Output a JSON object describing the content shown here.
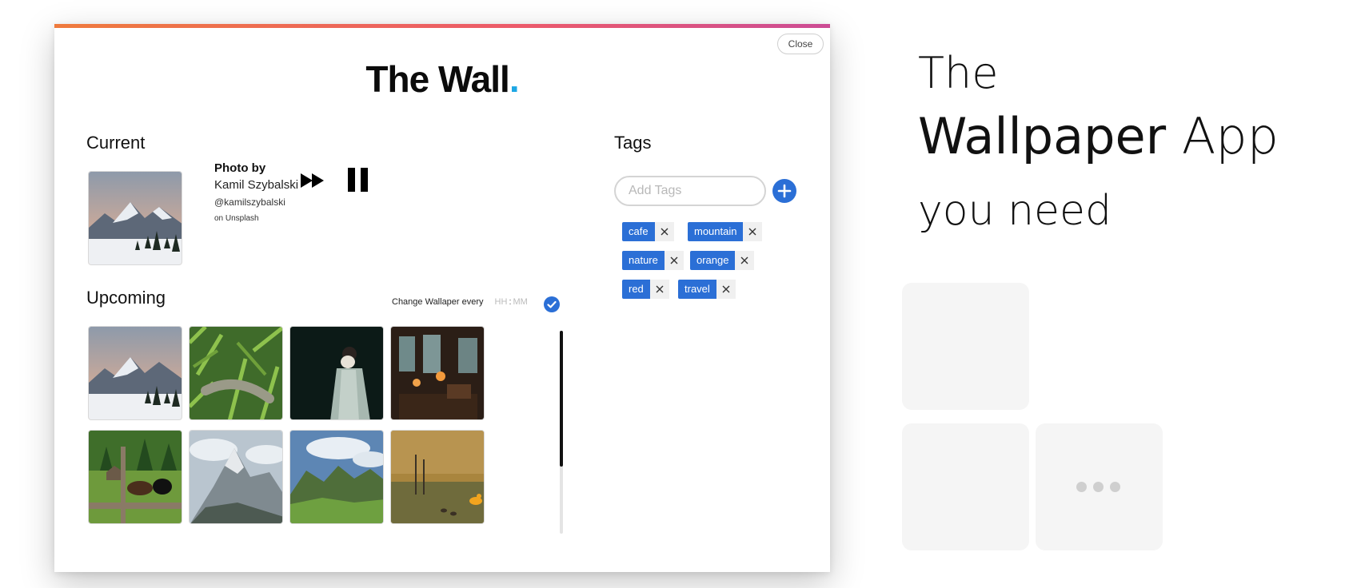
{
  "window": {
    "close_label": "Close",
    "title_main": "The Wall",
    "title_dot": "."
  },
  "current": {
    "heading": "Current",
    "credit_by": "Photo by",
    "credit_name": "Kamil Szybalski",
    "credit_handle": "@kamilszybalski",
    "credit_source": "on Unsplash"
  },
  "upcoming": {
    "heading": "Upcoming",
    "interval_label": "Change Wallaper every",
    "hh_placeholder": "HH",
    "separator": ":",
    "mm_placeholder": "MM",
    "photos": [
      "mountain-snow",
      "lizard-grass",
      "woman-fan",
      "cafe-interior",
      "cows-forest",
      "rocky-peak",
      "green-valley",
      "ducks-pond"
    ]
  },
  "tags": {
    "heading": "Tags",
    "input_placeholder": "Add Tags",
    "items": [
      {
        "label": "cafe"
      },
      {
        "label": "mountain"
      },
      {
        "label": "nature"
      },
      {
        "label": "orange"
      },
      {
        "label": "red"
      },
      {
        "label": "travel"
      }
    ]
  },
  "promo": {
    "line1": "The",
    "line2_bold": "Wallpaper",
    "line2_light": "App",
    "line3": "you need"
  },
  "colors": {
    "accent": "#2b6fd6",
    "title_dot": "#1ea7e4",
    "bar_start": "#ef7b3d",
    "bar_end": "#cc4c95"
  }
}
